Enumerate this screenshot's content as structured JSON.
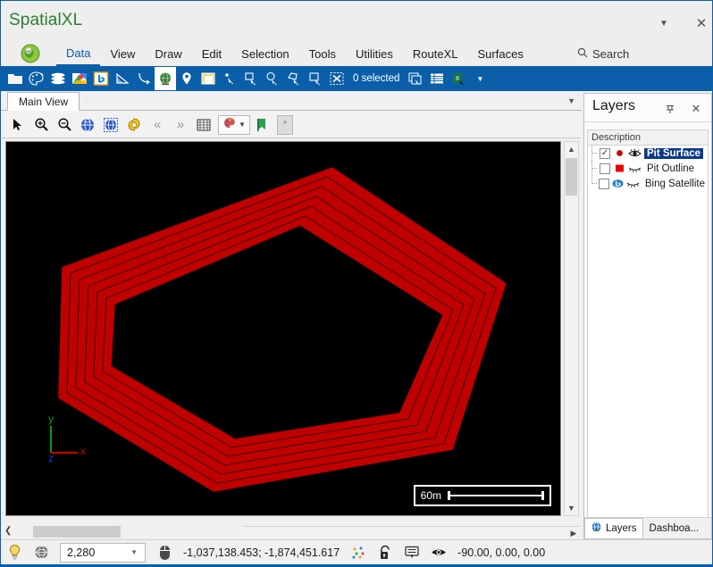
{
  "window": {
    "app_title": "SpatialXL",
    "caret_icon": "chevron-down-icon",
    "close_icon": "close-icon"
  },
  "menu": {
    "logo_icon": "spatialxl-logo-icon",
    "items": [
      {
        "label": "Data",
        "active": true
      },
      {
        "label": "View",
        "active": false
      },
      {
        "label": "Draw",
        "active": false
      },
      {
        "label": "Edit",
        "active": false
      },
      {
        "label": "Selection",
        "active": false
      },
      {
        "label": "Tools",
        "active": false
      },
      {
        "label": "Utilities",
        "active": false
      },
      {
        "label": "RouteXL",
        "active": false
      },
      {
        "label": "Surfaces",
        "active": false
      }
    ],
    "search_label": "Search",
    "search_icon": "search-icon"
  },
  "ribbon": {
    "selected_label": "0 selected",
    "icons": [
      "open-folder-icon",
      "palette-icon",
      "layers-stack-icon",
      "google-maps-icon",
      "bing-maps-icon",
      "triangle-measure-icon",
      "curve-tool-icon",
      "globe-icon",
      "pin-marker-icon",
      "legend-icon",
      "select-point-icon",
      "select-rectangle-icon",
      "select-circle-icon",
      "select-polygon-icon",
      "select-box-icon",
      "clear-selection-icon",
      "copy-selection-icon",
      "table-view-icon",
      "excel-export-icon",
      "overflow-caret-icon"
    ]
  },
  "view_tab": {
    "label": "Main View",
    "overflow_icon": "chevron-down-icon"
  },
  "view_toolbar": {
    "icons": [
      "pointer-arrow-icon",
      "zoom-in-icon",
      "zoom-out-icon",
      "zoom-extents-icon",
      "zoom-previous-icon",
      "settings-gear-icon",
      "rewind-icon",
      "fast-forward-icon",
      "grid-icon",
      "palette-dropdown-icon",
      "bookmark-flag-icon",
      "more-options-icon"
    ]
  },
  "map": {
    "scale_label": "60m",
    "axis": {
      "x_label": "x",
      "y_label": "y",
      "z_label": "z"
    },
    "background_color": "#000000",
    "pit_color": "#c00000",
    "scroll_up_icon": "chevron-up-icon",
    "scroll_down_icon": "chevron-down-icon",
    "scroll_left_icon": "chevron-left-icon",
    "scroll_right_icon": "chevron-right-icon"
  },
  "layers": {
    "title": "Layers",
    "pin_icon": "pin-icon",
    "close_icon": "close-icon",
    "column_header": "Description",
    "items": [
      {
        "label": "Pit Surface",
        "checked": true,
        "selected": true,
        "swatch_color": "#cc0000",
        "swatch_icon": "filled-circle-icon",
        "visibility_icon": "eye-open-icon"
      },
      {
        "label": "Pit Outline",
        "checked": false,
        "selected": false,
        "swatch_color": "#ee0000",
        "swatch_icon": "filled-square-icon",
        "visibility_icon": "eye-closed-icon"
      },
      {
        "label": "Bing Satellite",
        "checked": false,
        "selected": false,
        "swatch_color": "#2a7fc9",
        "swatch_icon": "bing-maps-icon",
        "visibility_icon": "eye-closed-icon"
      }
    ],
    "tabs": [
      {
        "label": "Layers",
        "icon": "globe-icon",
        "active": true
      },
      {
        "label": "Dashboa...",
        "icon": "",
        "active": false
      }
    ]
  },
  "status": {
    "lightbulb_icon": "lightbulb-icon",
    "globe_icon": "globe-icon",
    "scale_value": "2,280",
    "scale_dropdown_icon": "chevron-down-icon",
    "mouse_icon": "mouse-icon",
    "coordinates": "-1,037,138.453; -1,874,451.617",
    "points_icon": "scatter-points-icon",
    "lock_icon": "unlock-icon",
    "note_icon": "note-icon",
    "eye_icon": "eye-open-icon",
    "view_angles": "-90.00, 0.00, 0.00"
  }
}
